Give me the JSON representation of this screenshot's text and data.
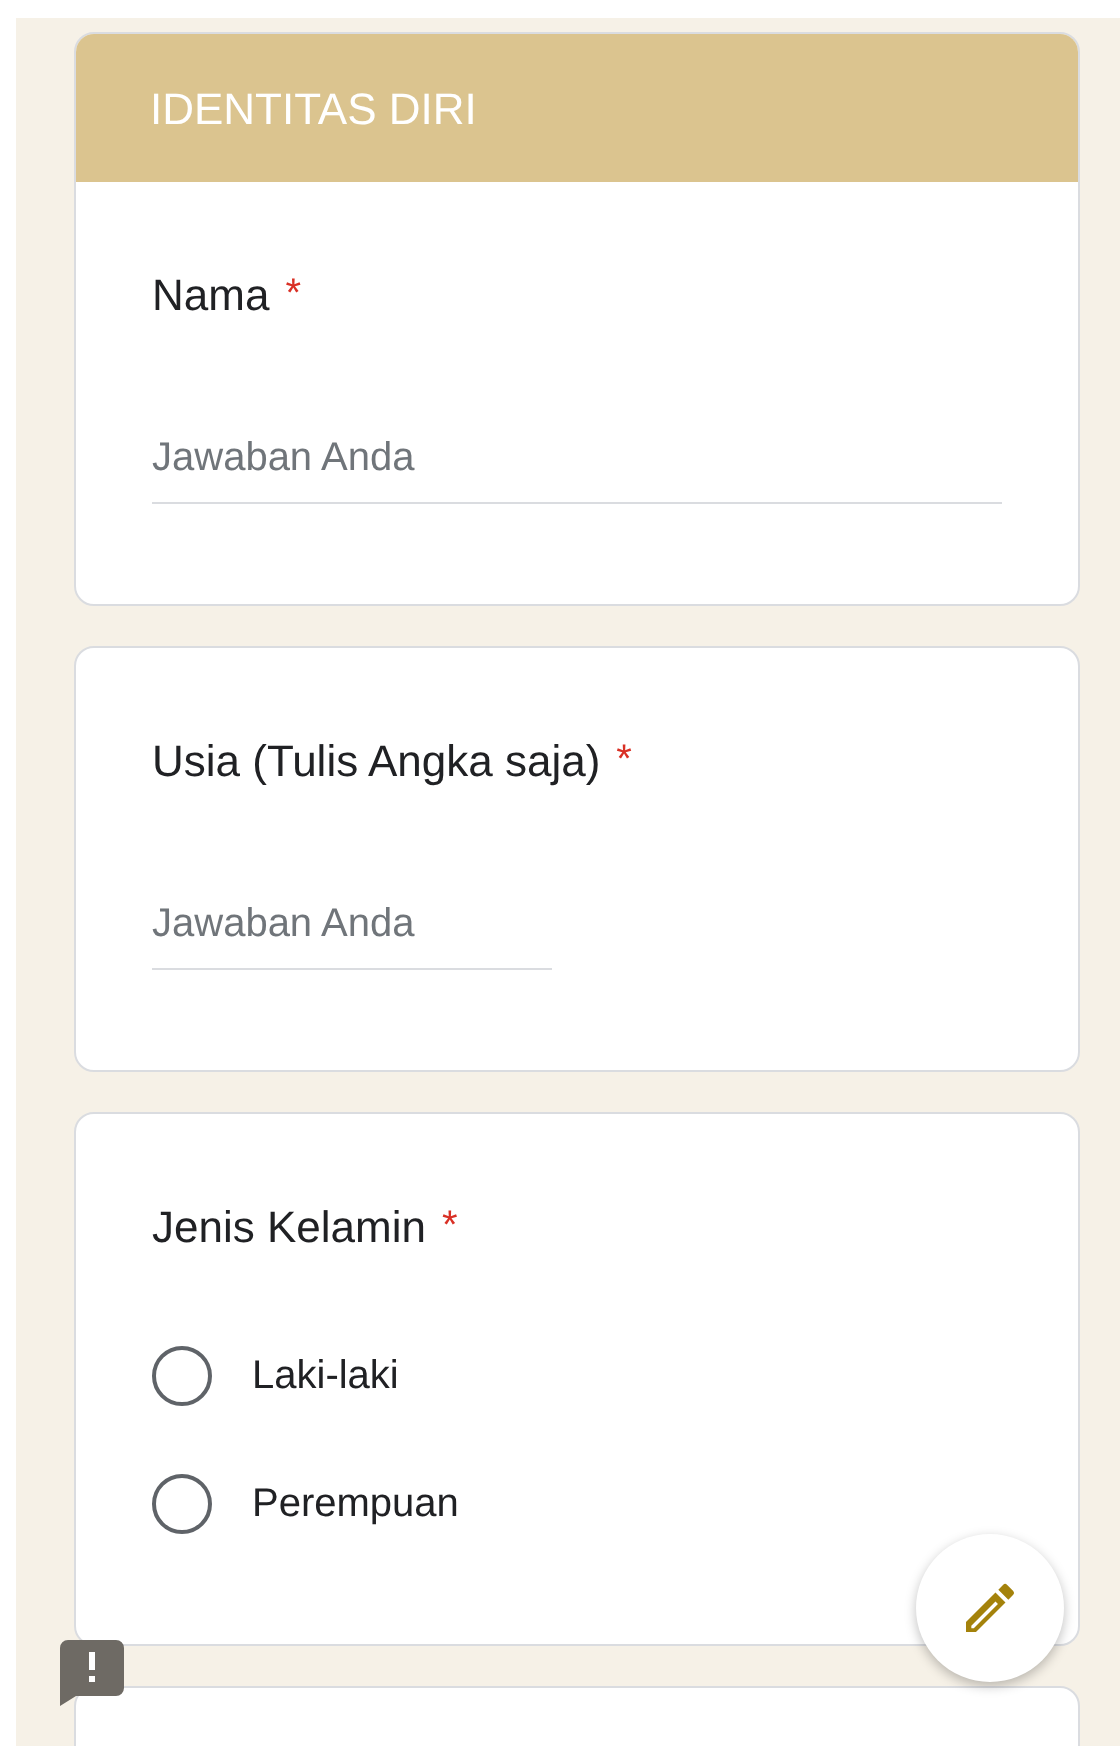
{
  "section_title": "IDENTITAS DIRI",
  "questions": [
    {
      "kind": "text",
      "title": "Nama",
      "required_mark": "*",
      "placeholder": "Jawaban Anda"
    },
    {
      "kind": "number",
      "title": "Usia (Tulis Angka saja)",
      "required_mark": "*",
      "placeholder": "Jawaban Anda"
    },
    {
      "kind": "radio",
      "title": "Jenis Kelamin",
      "required_mark": "*",
      "options": [
        {
          "label": "Laki-laki",
          "selected": false
        },
        {
          "label": "Perempuan",
          "selected": false
        }
      ]
    }
  ]
}
